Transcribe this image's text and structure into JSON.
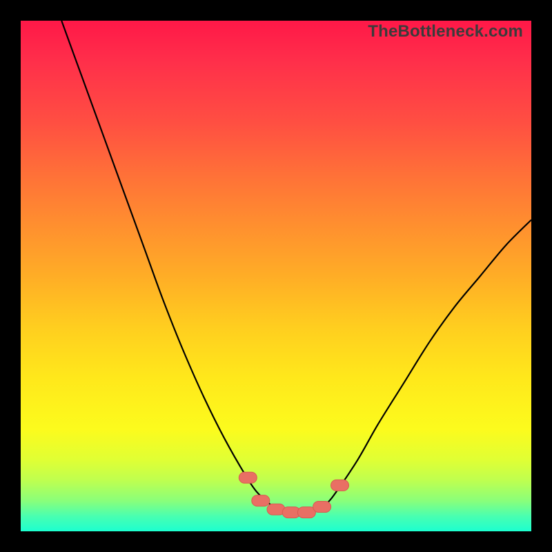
{
  "watermark": "TheBottleneck.com",
  "colors": {
    "frame": "#000000",
    "curve_stroke": "#000000",
    "marker_fill": "#e96f64",
    "marker_stroke": "#d85a50"
  },
  "chart_data": {
    "type": "line",
    "title": "",
    "xlabel": "",
    "ylabel": "",
    "xlim": [
      0,
      100
    ],
    "ylim": [
      0,
      100
    ],
    "grid": false,
    "legend": false,
    "series": [
      {
        "name": "left_branch",
        "x": [
          8,
          12,
          16,
          20,
          24,
          28,
          32,
          36,
          40,
          44,
          46,
          48,
          50,
          52
        ],
        "y": [
          100,
          89,
          78,
          67,
          56,
          45,
          35,
          26,
          18,
          11,
          8,
          6,
          4.5,
          3.8
        ]
      },
      {
        "name": "right_branch",
        "x": [
          52,
          54,
          56,
          58,
          60,
          62,
          66,
          70,
          75,
          80,
          85,
          90,
          95,
          100
        ],
        "y": [
          3.8,
          3.6,
          3.7,
          4.2,
          5.5,
          8,
          14,
          21,
          29,
          37,
          44,
          50,
          56,
          61
        ]
      }
    ],
    "markers": [
      {
        "name": "marker_1",
        "x": 44.5,
        "y": 10.5
      },
      {
        "name": "marker_2",
        "x": 47.0,
        "y": 6.0
      },
      {
        "name": "marker_3",
        "x": 50.0,
        "y": 4.3
      },
      {
        "name": "marker_4",
        "x": 53.0,
        "y": 3.7
      },
      {
        "name": "marker_5",
        "x": 56.0,
        "y": 3.7
      },
      {
        "name": "marker_6",
        "x": 59.0,
        "y": 4.8
      },
      {
        "name": "marker_7",
        "x": 62.5,
        "y": 9.0
      }
    ],
    "annotations": []
  }
}
